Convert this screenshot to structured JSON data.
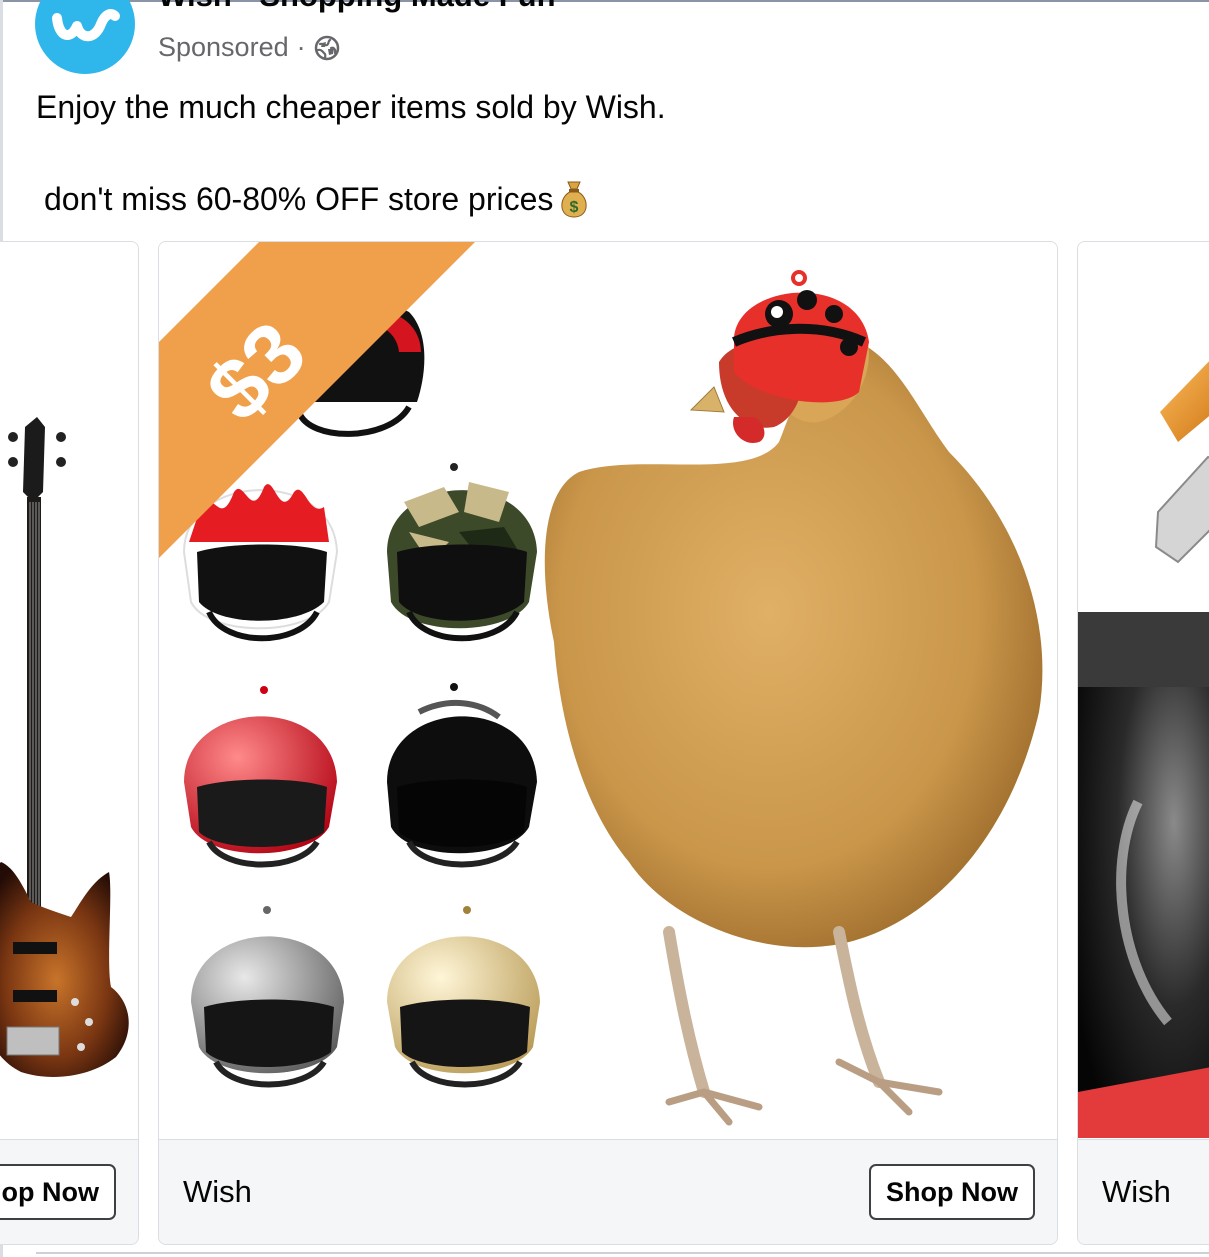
{
  "post": {
    "page_name": "Wish - Shopping Made Fun",
    "sponsored_label": "Sponsored",
    "separator": "·",
    "privacy_icon": "globe-icon",
    "line1": "Enjoy the much cheaper items sold by Wish.",
    "line2": "don't miss 60-80% OFF store prices",
    "emoji": "money-bag-emoji"
  },
  "carousel": {
    "left_card": {
      "button_label": "Shop Now",
      "image": "bass-guitar"
    },
    "main_card": {
      "price_badge": "$3",
      "title": "Wish",
      "button_label": "Shop Now",
      "image": "chicken-helmets",
      "badge_color": "#f0a04b"
    },
    "right_card": {
      "title": "Wish",
      "image": "partial-product"
    }
  },
  "colors": {
    "brand": "#2fb7ec",
    "secondary_text": "#65676b",
    "footer_bg": "#f5f6f7"
  }
}
